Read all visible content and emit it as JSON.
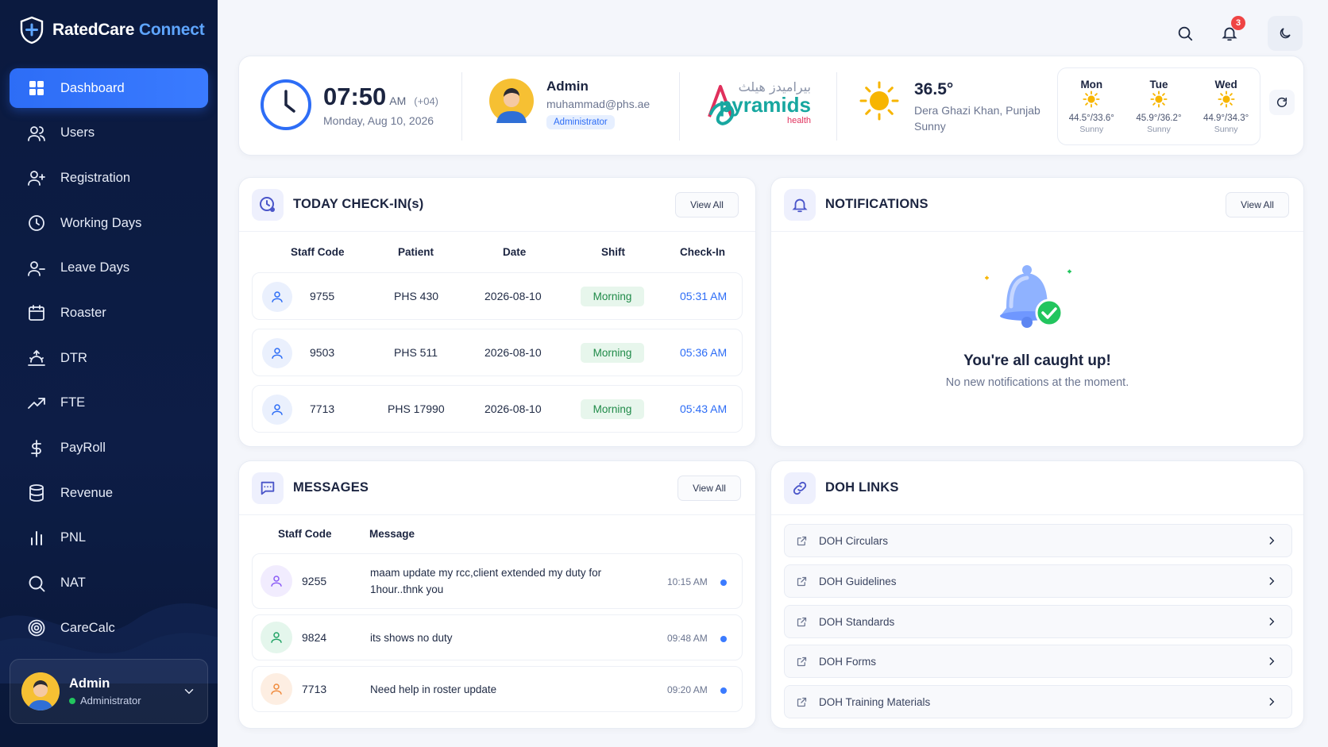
{
  "brand": {
    "name_main": "RatedCare",
    "name_accent": "Connect"
  },
  "sidebar": {
    "items": [
      {
        "label": "Dashboard",
        "icon": "dashboard-icon",
        "active": true
      },
      {
        "label": "Users",
        "icon": "users-icon"
      },
      {
        "label": "Registration",
        "icon": "user-plus-icon"
      },
      {
        "label": "Working Days",
        "icon": "clock-icon"
      },
      {
        "label": "Leave Days",
        "icon": "user-minus-icon"
      },
      {
        "label": "Roaster",
        "icon": "calendar-icon"
      },
      {
        "label": "DTR",
        "icon": "sunrise-icon"
      },
      {
        "label": "FTE",
        "icon": "trending-up-icon"
      },
      {
        "label": "PayRoll",
        "icon": "dollar-icon"
      },
      {
        "label": "Revenue",
        "icon": "database-icon"
      },
      {
        "label": "PNL",
        "icon": "bar-chart-icon"
      },
      {
        "label": "NAT",
        "icon": "search-icon"
      },
      {
        "label": "CareCalc",
        "icon": "target-icon"
      }
    ],
    "profile": {
      "name": "Admin",
      "role": "Administrator"
    }
  },
  "topbar": {
    "notification_count": "3"
  },
  "header": {
    "time": "07:50",
    "ampm": "AM",
    "tz": "(+04)",
    "date": "Monday, Aug 10, 2026",
    "admin_name": "Admin",
    "admin_email": "muhammad@phs.ae",
    "admin_role": "Administrator",
    "logo_arabic": "بيراميدز هيلث",
    "logo_main": "pyramids",
    "logo_sub": "health",
    "weather": {
      "temp": "36.5°",
      "location": "Dera Ghazi Khan, Punjab",
      "condition": "Sunny"
    },
    "forecast": [
      {
        "day": "Mon",
        "range": "44.5°/33.6°",
        "cond": "Sunny"
      },
      {
        "day": "Tue",
        "range": "45.9°/36.2°",
        "cond": "Sunny"
      },
      {
        "day": "Wed",
        "range": "44.9°/34.3°",
        "cond": "Sunny"
      }
    ]
  },
  "checkins": {
    "title": "TODAY CHECK-IN(s)",
    "view_all": "View All",
    "columns": [
      "Staff Code",
      "Patient",
      "Date",
      "Shift",
      "Check-In"
    ],
    "rows": [
      {
        "code": "9755",
        "patient": "PHS 430",
        "date": "2026-08-10",
        "shift": "Morning",
        "checkin": "05:31 AM"
      },
      {
        "code": "9503",
        "patient": "PHS 511",
        "date": "2026-08-10",
        "shift": "Morning",
        "checkin": "05:36 AM"
      },
      {
        "code": "7713",
        "patient": "PHS 17990",
        "date": "2026-08-10",
        "shift": "Morning",
        "checkin": "05:43 AM"
      }
    ]
  },
  "notifications": {
    "title": "NOTIFICATIONS",
    "view_all": "View All",
    "empty_title": "You're all caught up!",
    "empty_sub": "No new notifications at the moment."
  },
  "messages": {
    "title": "MESSAGES",
    "view_all": "View All",
    "columns": [
      "Staff Code",
      "Message"
    ],
    "rows": [
      {
        "code": "9255",
        "text": "maam update my rcc,client extended my duty for 1hour..thnk you",
        "time": "10:15 AM",
        "color": "#8b5cf6",
        "bg": "#f1ecfe"
      },
      {
        "code": "9824",
        "text": "its shows no duty",
        "time": "09:48 AM",
        "color": "#22a366",
        "bg": "#e4f6ec"
      },
      {
        "code": "7713",
        "text": "Need help in roster update",
        "time": "09:20 AM",
        "color": "#f08a3c",
        "bg": "#fdeee2"
      }
    ]
  },
  "doh": {
    "title": "DOH LINKS",
    "links": [
      "DOH Circulars",
      "DOH Guidelines",
      "DOH Standards",
      "DOH Forms",
      "DOH Training Materials"
    ]
  },
  "colors": {
    "primary": "#2d6df6",
    "sidebar": "#0b1a3f",
    "success": "#1f8a48"
  }
}
